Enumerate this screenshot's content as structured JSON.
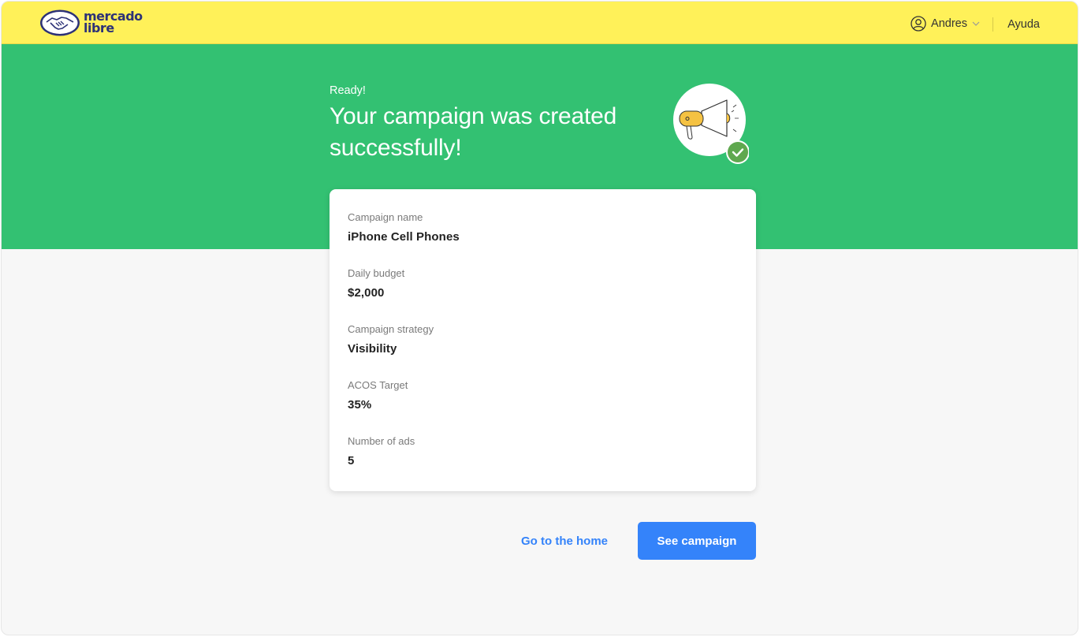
{
  "header": {
    "logo_line1": "mercado",
    "logo_line2": "libre",
    "user_name": "Andres",
    "help_label": "Ayuda"
  },
  "hero": {
    "eyebrow": "Ready!",
    "title": "Your campaign was created successfully!"
  },
  "summary": {
    "fields": [
      {
        "label": "Campaign name",
        "value": "iPhone Cell Phones"
      },
      {
        "label": "Daily budget",
        "value": "$2,000"
      },
      {
        "label": "Campaign strategy",
        "value": "Visibility"
      },
      {
        "label": "ACOS Target",
        "value": "35%"
      },
      {
        "label": "Number of ads",
        "value": "5"
      }
    ]
  },
  "actions": {
    "home_link": "Go to the home",
    "see_button": "See campaign"
  },
  "icons": {
    "logo": "handshake-logo-icon",
    "user": "user-circle-icon",
    "dropdown": "chevron-down-icon",
    "illustration": "megaphone-icon",
    "success": "check-icon"
  },
  "colors": {
    "header_bg": "#fff159",
    "banner_bg": "#33c172",
    "primary": "#3483fa",
    "success_badge": "#5fa84f",
    "brand_text": "#2d3277"
  }
}
